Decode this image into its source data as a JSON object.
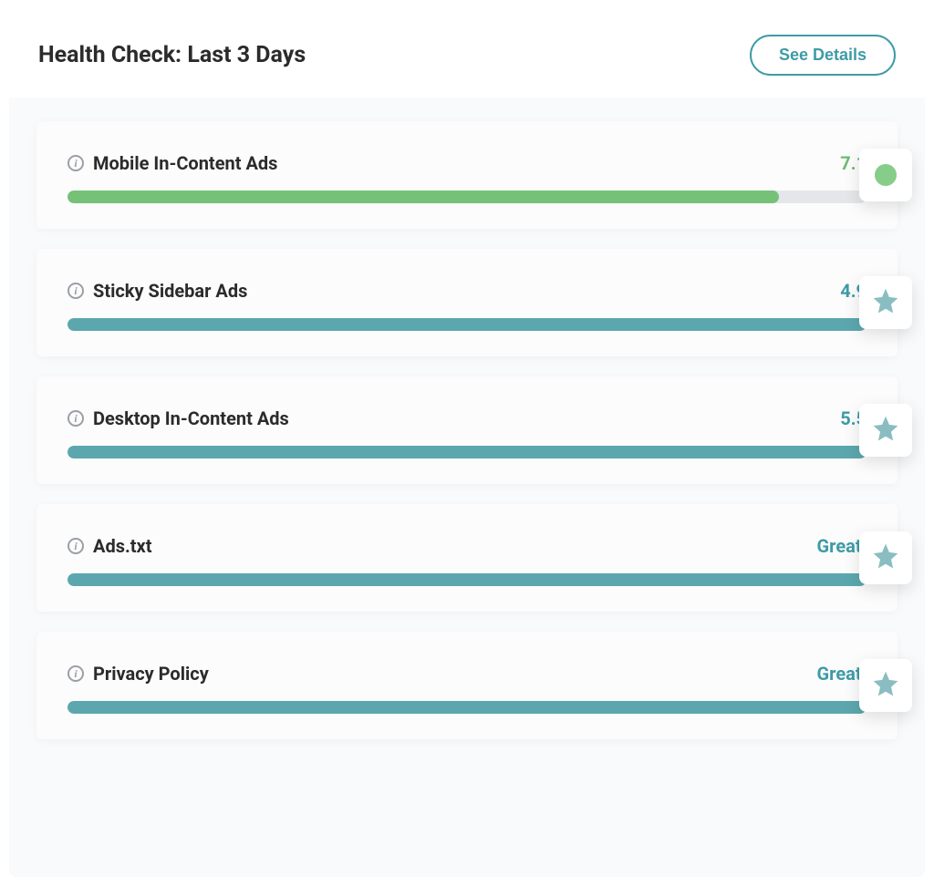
{
  "header": {
    "title": "Health Check: Last 3 Days",
    "button_label": "See Details"
  },
  "colors": {
    "teal": "#3e9ba5",
    "green": "#76c178",
    "teal_fill": "#5ca7ae"
  },
  "items": [
    {
      "title": "Mobile In-Content Ads",
      "score": "7.1",
      "percent": 89,
      "color": "green",
      "badge": "dot"
    },
    {
      "title": "Sticky Sidebar Ads",
      "score": "4.9",
      "percent": 100,
      "color": "teal",
      "badge": "star"
    },
    {
      "title": "Desktop In-Content Ads",
      "score": "5.5",
      "percent": 100,
      "color": "teal",
      "badge": "star"
    },
    {
      "title": "Ads.txt",
      "score": "Great!",
      "percent": 100,
      "color": "teal",
      "badge": "star"
    },
    {
      "title": "Privacy Policy",
      "score": "Great!",
      "percent": 100,
      "color": "teal",
      "badge": "star"
    }
  ]
}
